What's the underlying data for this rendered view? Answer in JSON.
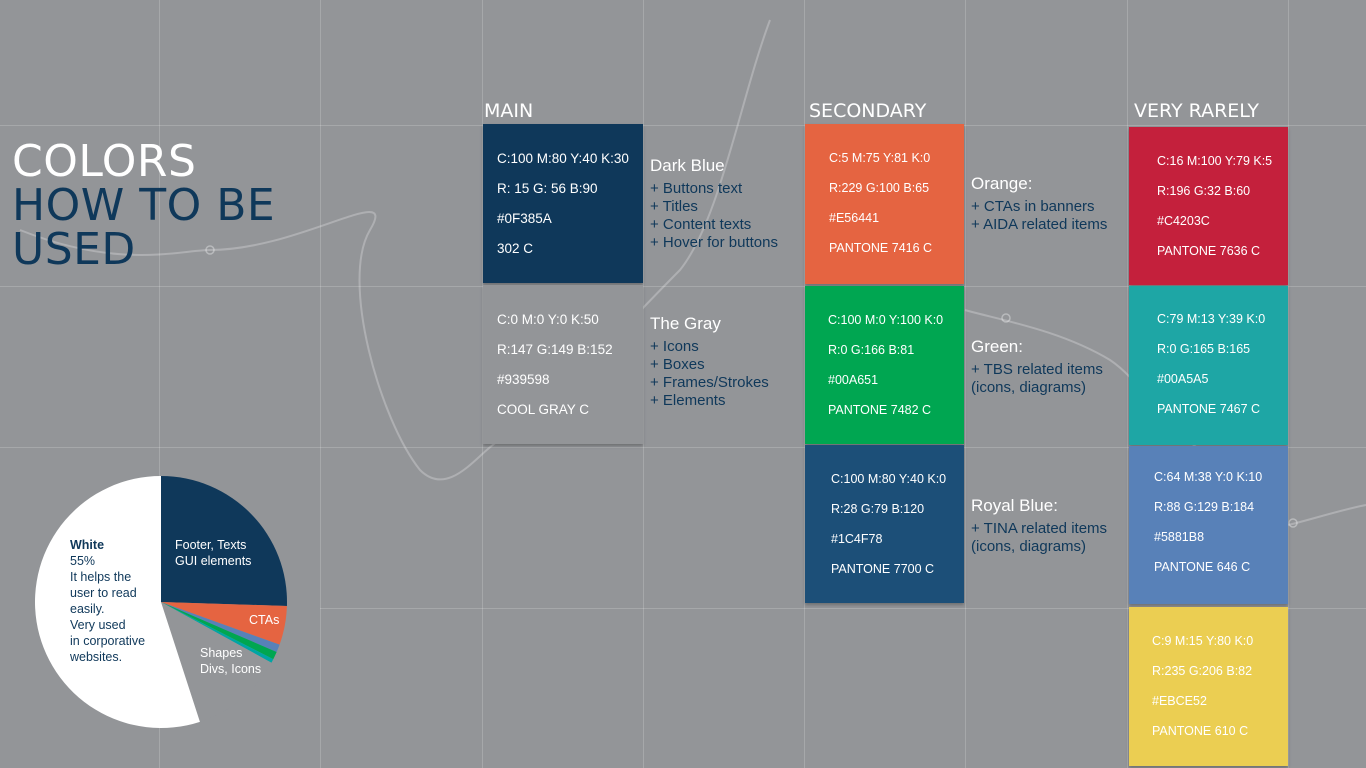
{
  "title": {
    "line1": "COLORS",
    "line2": "HOW TO BE",
    "line3": "USED"
  },
  "sections": {
    "main": "MAIN",
    "secondary": "SECONDARY",
    "very_rarely": "VERY RARELY"
  },
  "swatches": {
    "dark_blue": {
      "color": "#0F385A",
      "lines": [
        "C:100 M:80 Y:40 K:30",
        "R: 15 G: 56 B:90",
        "#0F385A",
        "302 C"
      ]
    },
    "gray": {
      "color": "#939598",
      "lines": [
        "C:0 M:0 Y:0 K:50",
        "R:147 G:149 B:152",
        "#939598",
        "COOL GRAY C"
      ]
    },
    "orange": {
      "color": "#E56441",
      "lines": [
        "C:5 M:75 Y:81 K:0",
        "R:229 G:100 B:65",
        "#E56441",
        "PANTONE 7416 C"
      ]
    },
    "green": {
      "color": "#00A651",
      "lines": [
        "C:100 M:0 Y:100 K:0",
        "R:0 G:166 B:81",
        "#00A651",
        "PANTONE 7482 C"
      ]
    },
    "royal_blue": {
      "color": "#1C4F78",
      "lines": [
        "C:100 M:80 Y:40 K:0",
        "R:28 G:79 B:120",
        "#1C4F78",
        "PANTONE 7700 C"
      ]
    },
    "red": {
      "color": "#C4203C",
      "lines": [
        "C:16 M:100 Y:79 K:5",
        "R:196 G:32 B:60",
        "#C4203C",
        "PANTONE 7636 C"
      ]
    },
    "teal": {
      "color": "#00A5A5",
      "lines": [
        "C:79 M:13 Y:39 K:0",
        "R:0 G:165 B:165",
        "#00A5A5",
        "PANTONE 7467 C"
      ]
    },
    "steel_blue": {
      "color": "#5881B8",
      "lines": [
        "C:64 M:38 Y:0 K:10",
        "R:88 G:129 B:184",
        "#5881B8",
        "PANTONE 646 C"
      ]
    },
    "yellow": {
      "color": "#EBCE52",
      "lines": [
        "C:9 M:15 Y:80 K:0",
        "R:235 G:206 B:82",
        "#EBCE52",
        "PANTONE 610 C"
      ]
    }
  },
  "descriptions": {
    "dark_blue": {
      "title": "Dark Blue",
      "items": [
        "+ Buttons text",
        "+ Titles",
        "+ Content texts",
        "+ Hover for buttons"
      ]
    },
    "gray": {
      "title": "The Gray",
      "items": [
        "+ Icons",
        "+ Boxes",
        "+ Frames/Strokes",
        "+ Elements"
      ]
    },
    "orange": {
      "title": "Orange:",
      "items": [
        "+ CTAs in banners",
        "+ AIDA related items"
      ]
    },
    "green": {
      "title": "Green:",
      "items": [
        "+ TBS related items",
        "(icons, diagrams)"
      ]
    },
    "royal_blue": {
      "title": "Royal Blue:",
      "items": [
        "+ TINA related items",
        "(icons, diagrams)"
      ]
    }
  },
  "chart_data": {
    "type": "pie",
    "slices": [
      {
        "name": "Footer, Texts GUI elements",
        "value": 25.5,
        "color": "#0F385A"
      },
      {
        "name": "CTAs",
        "value": 5,
        "color": "#E56441"
      },
      {
        "name": "Royal Blue",
        "value": 1,
        "color": "#5881B8"
      },
      {
        "name": "Green",
        "value": 1,
        "color": "#00A651"
      },
      {
        "name": "Teal",
        "value": 0.5,
        "color": "#00A5A5"
      },
      {
        "name": "Shapes Divs, Icons",
        "value": 12,
        "color": "#939598"
      },
      {
        "name": "White",
        "value": 55,
        "color": "#FFFFFF"
      }
    ],
    "labels": {
      "white_title": "White",
      "white_pct": "55%",
      "white_text": [
        "It helps the",
        "user to read",
        "easily.",
        "Very used",
        "in corporative",
        "websites."
      ],
      "navy": [
        "Footer, Texts",
        "GUI elements"
      ],
      "ctas": "CTAs",
      "gray": [
        "Shapes",
        "Divs, Icons"
      ]
    }
  }
}
